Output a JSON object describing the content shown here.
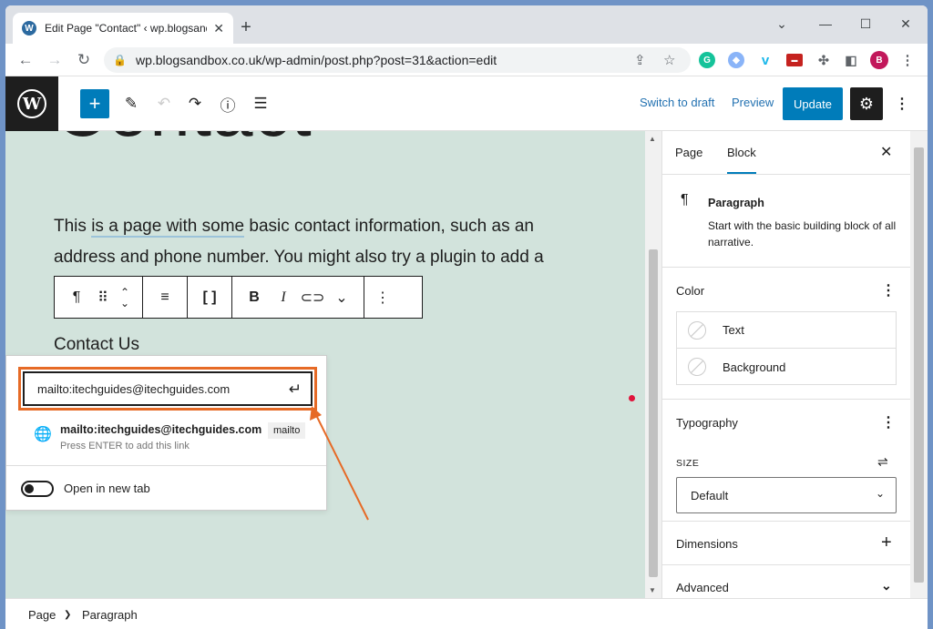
{
  "browser": {
    "tab_title": "Edit Page \"Contact\" ‹ wp.blogsandbox.co.uk",
    "url": "wp.blogsandbox.co.uk/wp-admin/post.php?post=31&action=edit",
    "profile_initial": "B"
  },
  "wp": {
    "switch_to_draft": "Switch to draft",
    "preview": "Preview",
    "update": "Update",
    "accent": "#007cba"
  },
  "editor": {
    "page_title": "Contact",
    "paragraph_text_before": "This ",
    "paragraph_highlight": "is a page with some",
    "paragraph_text_after": " basic contact information, such as an address and phone number. You might also try a plugin to add a",
    "contact_heading": "Contact Us"
  },
  "link_popover": {
    "url_value": "mailto:itechguides@itechguides.com",
    "suggestion_title": "mailto:itechguides@itechguides.com",
    "suggestion_hint": "Press ENTER to add this link",
    "suggestion_type": "mailto",
    "open_new_tab": "Open in new tab",
    "highlight_color": "#e66a26"
  },
  "sidebar": {
    "tabs": [
      "Page",
      "Block"
    ],
    "block_name": "Paragraph",
    "block_desc": "Start with the basic building block of all narrative.",
    "color_title": "Color",
    "color_items": [
      "Text",
      "Background"
    ],
    "typography_title": "Typography",
    "size_label": "SIZE",
    "size_value": "Default",
    "dimensions_title": "Dimensions",
    "advanced_title": "Advanced"
  },
  "breadcrumb": [
    "Page",
    "Paragraph"
  ]
}
